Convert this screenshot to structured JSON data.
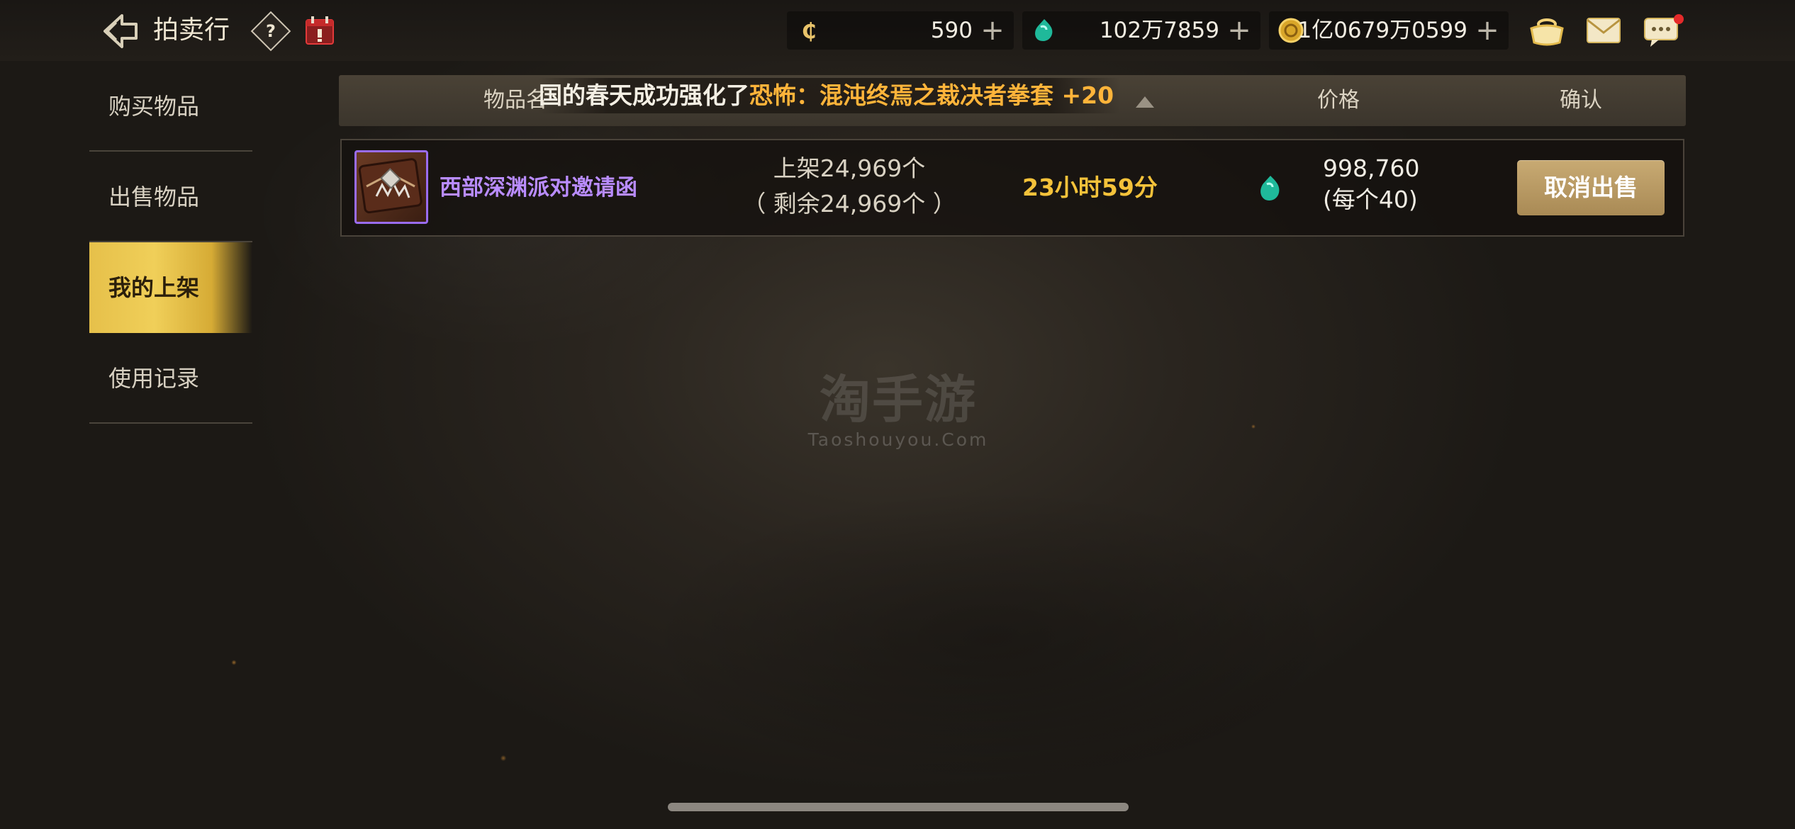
{
  "header": {
    "title": "拍卖行",
    "icons": {
      "back": "back-arrow-icon",
      "help": "help-icon",
      "calendar": "calendar-icon"
    }
  },
  "currencies": [
    {
      "name": "credit",
      "icon": "c-coin-icon",
      "value": "590"
    },
    {
      "name": "gem",
      "icon": "gem-icon",
      "value": "102万7859"
    },
    {
      "name": "gold",
      "icon": "gold-coin-icon",
      "value": "1亿0679万0599"
    }
  ],
  "top_icons": [
    "pot-icon",
    "mail-icon",
    "chat-icon"
  ],
  "ticker": {
    "prefix": "国的春天成功强化了",
    "highlight": "恐怖：混沌终焉之裁决者拳套 +20"
  },
  "sidebar": {
    "items": [
      {
        "label": "购买物品",
        "active": false
      },
      {
        "label": "出售物品",
        "active": false
      },
      {
        "label": "我的上架",
        "active": true
      },
      {
        "label": "使用记录",
        "active": false
      }
    ]
  },
  "table": {
    "headers": {
      "item": "物品名",
      "price": "价格",
      "confirm": "确认"
    },
    "rows": [
      {
        "name": "西部深渊派对邀请函",
        "listed": "上架24,969个",
        "remaining": "（ 剩余24,969个 ）",
        "time_left": "23小时59分",
        "price": "998,760",
        "unit_price": "(每个40)",
        "action": "取消出售"
      }
    ]
  },
  "watermark": {
    "main": "淘手游",
    "sub": "Taoshouyou.Com"
  },
  "colors": {
    "active_tab": "#f0cf59",
    "item_name": "#b98cff",
    "time": "#f4c23a",
    "ticker_highlight": "#ffb43a",
    "button": "#b8996a"
  }
}
